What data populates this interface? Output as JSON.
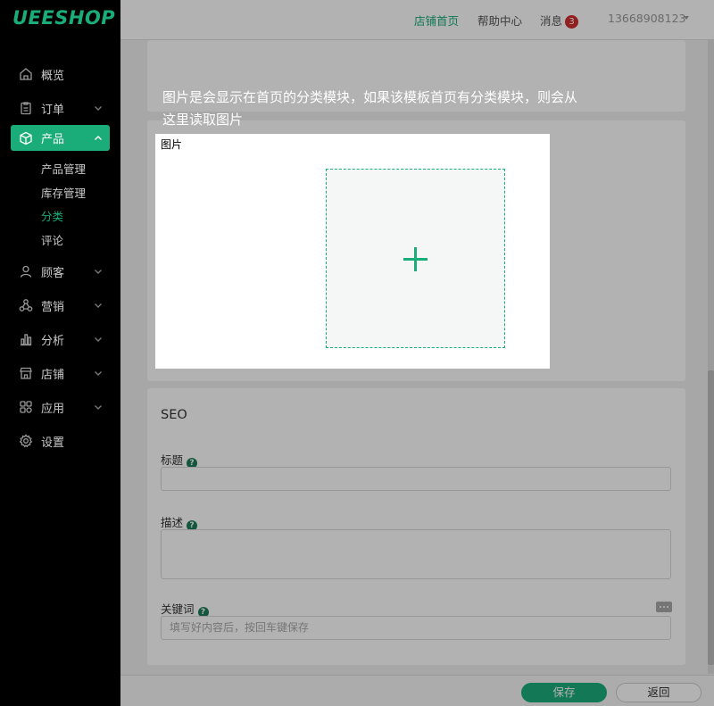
{
  "brand": {
    "logo_text": "UEESHOP",
    "accent": "#1aad7a"
  },
  "sidebar": {
    "items": [
      {
        "label": "概览",
        "icon": "home-icon"
      },
      {
        "label": "订单",
        "icon": "clipboard-icon"
      },
      {
        "label": "产品",
        "icon": "box-icon",
        "active": true,
        "children": [
          {
            "label": "产品管理"
          },
          {
            "label": "库存管理"
          },
          {
            "label": "分类",
            "current": true
          },
          {
            "label": "评论"
          }
        ]
      },
      {
        "label": "顾客",
        "icon": "user-icon"
      },
      {
        "label": "营销",
        "icon": "marketing-icon"
      },
      {
        "label": "分析",
        "icon": "bar-chart-icon"
      },
      {
        "label": "店铺",
        "icon": "store-icon"
      },
      {
        "label": "应用",
        "icon": "apps-icon"
      },
      {
        "label": "设置",
        "icon": "gear-icon"
      }
    ]
  },
  "topbar": {
    "store_home": "店铺首页",
    "help_center": "帮助中心",
    "messages_label": "消息",
    "messages_count": "3",
    "user": "13668908123"
  },
  "tooltip": {
    "text": "图片是会显示在首页的分类模块，如果该模板首页有分类模块，则会从这里读取图片"
  },
  "popup": {
    "image_label": "图片"
  },
  "seo": {
    "title": "SEO",
    "title_label": "标题",
    "description_label": "描述",
    "keywords_label": "关键词",
    "keywords_placeholder": "填写好内容后，按回车键保存",
    "help_glyph": "?"
  },
  "footer": {
    "save": "保存",
    "back": "返回"
  }
}
